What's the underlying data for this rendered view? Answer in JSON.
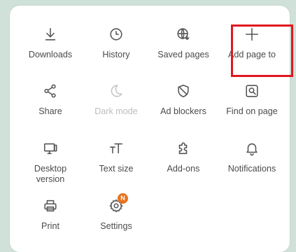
{
  "menu": {
    "items": [
      {
        "label": "Downloads",
        "icon": "download-icon"
      },
      {
        "label": "History",
        "icon": "clock-icon"
      },
      {
        "label": "Saved pages",
        "icon": "globe-download-icon"
      },
      {
        "label": "Add page to",
        "icon": "plus-icon"
      },
      {
        "label": "Share",
        "icon": "share-icon"
      },
      {
        "label": "Dark mode",
        "icon": "moon-icon",
        "disabled": true
      },
      {
        "label": "Ad blockers",
        "icon": "shield-icon"
      },
      {
        "label": "Find on page",
        "icon": "find-on-page-icon"
      },
      {
        "label": "Desktop\nversion",
        "icon": "desktop-icon"
      },
      {
        "label": "Text size",
        "icon": "text-size-icon"
      },
      {
        "label": "Add-ons",
        "icon": "puzzle-icon"
      },
      {
        "label": "Notifications",
        "icon": "bell-icon"
      },
      {
        "label": "Print",
        "icon": "printer-icon"
      },
      {
        "label": "Settings",
        "icon": "gear-icon",
        "badge": "N"
      }
    ]
  },
  "colors": {
    "background": "#cfe1d8",
    "panel": "#ffffff",
    "text": "#4b4b4b",
    "disabled_text": "#bdbdbd",
    "highlight_border": "#e0181e",
    "badge": "#e8731e"
  }
}
